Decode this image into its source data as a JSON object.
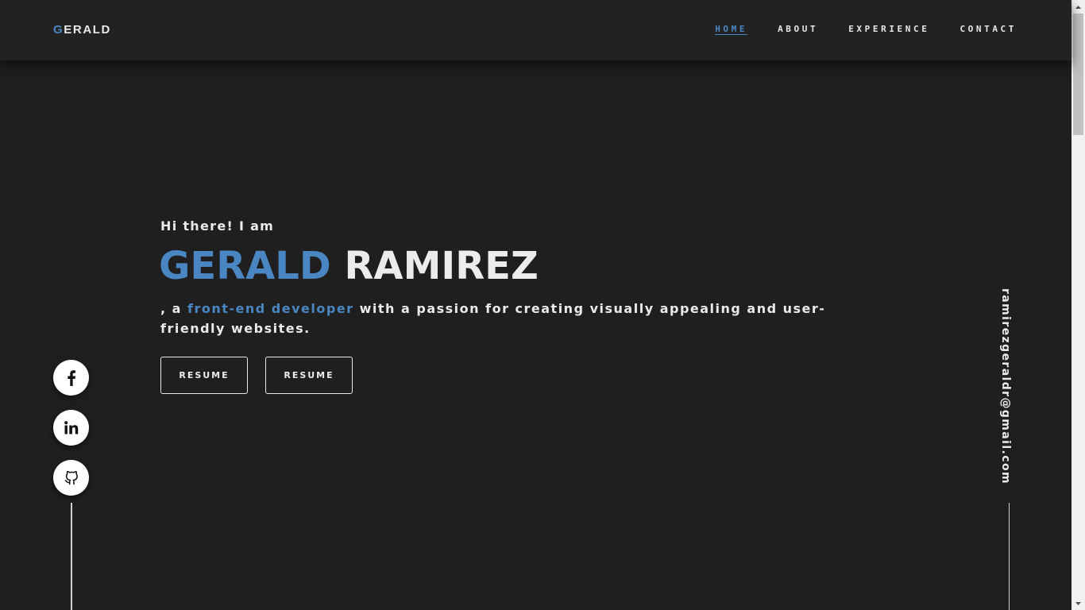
{
  "header": {
    "logo_initial": "G",
    "logo_rest": "ERALD",
    "nav": [
      {
        "label": "HOME",
        "active": true
      },
      {
        "label": "ABOUT",
        "active": false
      },
      {
        "label": "EXPERIENCE",
        "active": false
      },
      {
        "label": "CONTACT",
        "active": false
      }
    ]
  },
  "hero": {
    "greeting": "Hi there! I am",
    "first_name": "GERALD",
    "last_name": "RAMIREZ",
    "tagline_prefix": ", a ",
    "tagline_role": "front-end developer",
    "tagline_suffix": " with a passion for creating visually appealing and user-friendly websites.",
    "buttons": [
      "RESUME",
      "RESUME"
    ]
  },
  "socials": [
    {
      "icon": "facebook-icon"
    },
    {
      "icon": "linkedin-icon"
    },
    {
      "icon": "github-icon"
    }
  ],
  "email": "ramirezgeraldr@gmail.com",
  "colors": {
    "background": "#1f1f1f",
    "header": "#222222",
    "accent": "#4a86c2",
    "text": "#eaeaea"
  }
}
